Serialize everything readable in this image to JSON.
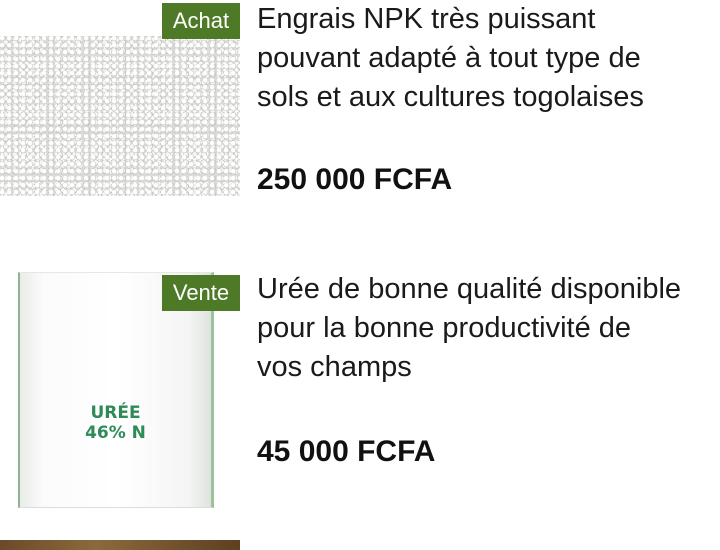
{
  "listings": [
    {
      "badge": "Achat",
      "description_lines": [
        "Engrais NPK très puissant",
        "pouvant adapté à tout type de",
        "sols et aux cultures togolaises"
      ],
      "price": "250 000 FCFA",
      "image": "fertilizer-granules"
    },
    {
      "badge": "Vente",
      "description_lines": [
        "Urée de bonne qualité disponible",
        "pour la bonne productivité de",
        "vos champs"
      ],
      "price": "45 000 FCFA",
      "image": "urea-sack",
      "image_text": [
        "URÉE",
        "46% N"
      ]
    }
  ],
  "colors": {
    "badge_bg": "#4e7a28",
    "badge_text": "#ffffff",
    "sack_print": "#2e8b57"
  }
}
